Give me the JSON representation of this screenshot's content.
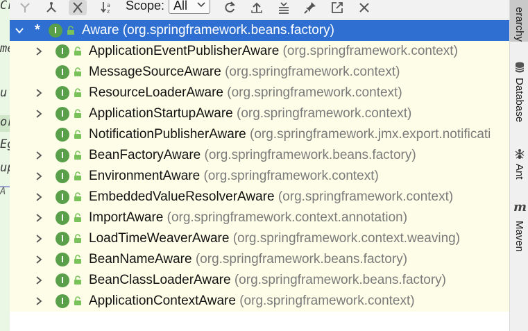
{
  "editor_glyphs": [
    "Cr",
    "me",
    "u",
    "or",
    "Eg",
    "up",
    "A"
  ],
  "toolbar": {
    "scope_label": "Scope:",
    "scope_value": "All",
    "buttons": [
      {
        "icon": "supertypes-icon"
      },
      {
        "icon": "subtypes-icon"
      },
      {
        "icon": "class-hierarchy-icon"
      },
      {
        "icon": "sort-alphabetically-icon"
      },
      {
        "icon": "refresh-icon"
      },
      {
        "icon": "export-icon"
      },
      {
        "icon": "collapse-all-icon"
      },
      {
        "icon": "pin-icon"
      },
      {
        "icon": "open-in-window-icon"
      },
      {
        "icon": "close-icon"
      }
    ]
  },
  "tree": {
    "root": {
      "marker": "*",
      "name": "Aware",
      "package": "(org.springframework.beans.factory)",
      "expanded": true,
      "selected": true
    },
    "children": [
      {
        "name": "ApplicationEventPublisherAware",
        "package": "(org.springframework.context)",
        "expandable": true
      },
      {
        "name": "MessageSourceAware",
        "package": "(org.springframework.context)",
        "expandable": false
      },
      {
        "name": "ResourceLoaderAware",
        "package": "(org.springframework.context)",
        "expandable": true
      },
      {
        "name": "ApplicationStartupAware",
        "package": "(org.springframework.context)",
        "expandable": true
      },
      {
        "name": "NotificationPublisherAware",
        "package": "(org.springframework.jmx.export.notificati",
        "expandable": false
      },
      {
        "name": "BeanFactoryAware",
        "package": "(org.springframework.beans.factory)",
        "expandable": true
      },
      {
        "name": "EnvironmentAware",
        "package": "(org.springframework.context)",
        "expandable": true
      },
      {
        "name": "EmbeddedValueResolverAware",
        "package": "(org.springframework.context)",
        "expandable": true
      },
      {
        "name": "ImportAware",
        "package": "(org.springframework.context.annotation)",
        "expandable": true
      },
      {
        "name": "LoadTimeWeaverAware",
        "package": "(org.springframework.context.weaving)",
        "expandable": true
      },
      {
        "name": "BeanNameAware",
        "package": "(org.springframework.beans.factory)",
        "expandable": true
      },
      {
        "name": "BeanClassLoaderAware",
        "package": "(org.springframework.beans.factory)",
        "expandable": true
      },
      {
        "name": "ApplicationContextAware",
        "package": "(org.springframework.context)",
        "expandable": true
      }
    ],
    "interface_badge": "I"
  },
  "right_strip": {
    "tabs": [
      {
        "label": "erarchy",
        "icon": "",
        "active": true
      },
      {
        "label": "Database",
        "icon": "database-icon",
        "active": false
      },
      {
        "label": "Ant",
        "icon": "ant-icon",
        "active": false
      },
      {
        "label": "Maven",
        "icon": "maven-icon",
        "active": false
      }
    ],
    "maven_glyph": "m"
  },
  "colors": {
    "selection": "#2f6fd1",
    "tree_background": "#fefee8",
    "interface_icon": "#5aa04a",
    "package_text": "#7a7a7a"
  }
}
